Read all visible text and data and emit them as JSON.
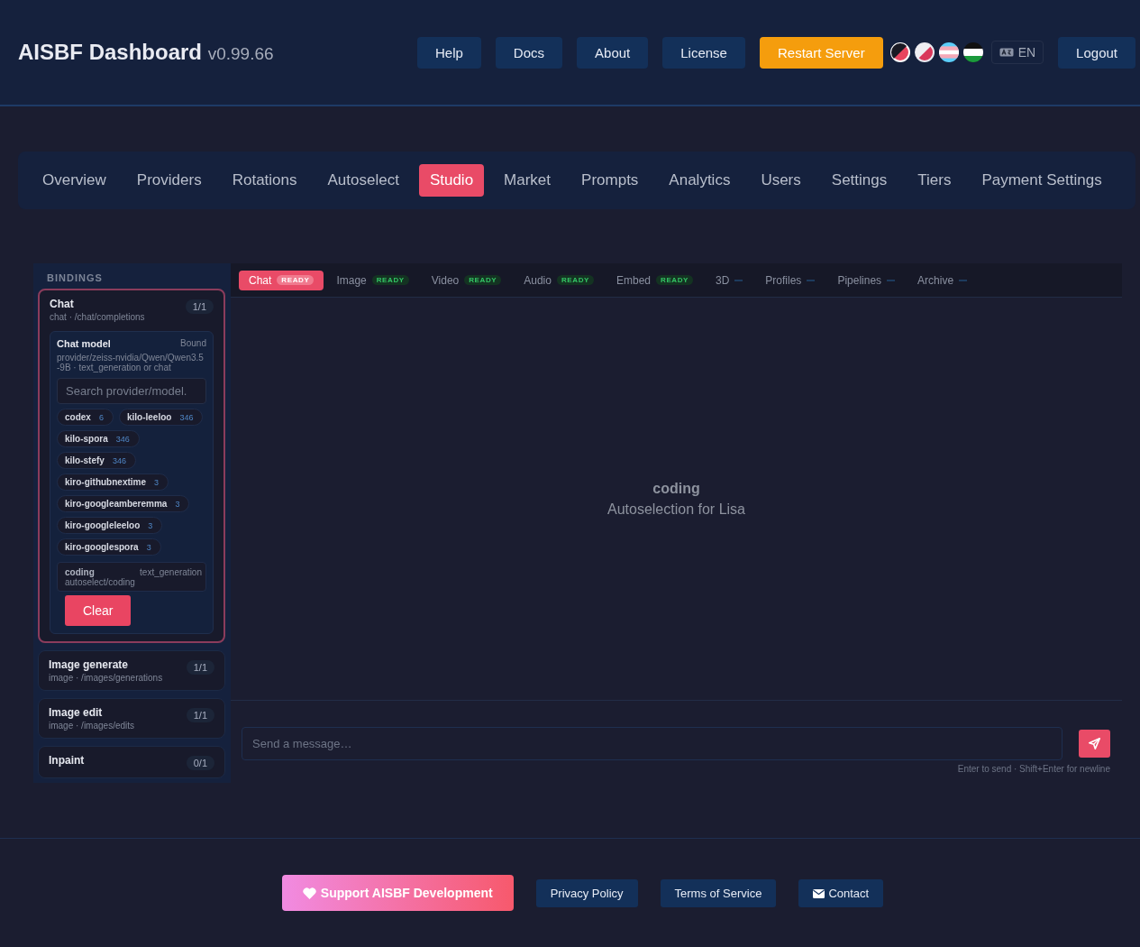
{
  "header": {
    "title": "AISBF Dashboard",
    "version": "v0.99.66",
    "buttons": [
      {
        "label": "Help",
        "kind": "plain"
      },
      {
        "label": "Docs",
        "kind": "plain"
      },
      {
        "label": "About",
        "kind": "plain"
      },
      {
        "label": "License",
        "kind": "plain"
      },
      {
        "label": "Restart Server",
        "kind": "warning"
      }
    ],
    "language": "EN",
    "logout": "Logout"
  },
  "nav": [
    {
      "label": "Overview",
      "selected": false
    },
    {
      "label": "Providers",
      "selected": false
    },
    {
      "label": "Rotations",
      "selected": false
    },
    {
      "label": "Autoselect",
      "selected": false
    },
    {
      "label": "Studio",
      "selected": true
    },
    {
      "label": "Market",
      "selected": false
    },
    {
      "label": "Prompts",
      "selected": false
    },
    {
      "label": "Analytics",
      "selected": false
    },
    {
      "label": "Users",
      "selected": false
    },
    {
      "label": "Settings",
      "selected": false
    },
    {
      "label": "Tiers",
      "selected": false
    },
    {
      "label": "Payment Settings",
      "selected": false
    }
  ],
  "sidebar": {
    "heading": "BINDINGS",
    "bindings": [
      {
        "name": "Chat",
        "path": "chat · /chat/completions",
        "count": "1/1",
        "expanded": true,
        "model": {
          "title": "Chat model",
          "status": "Bound",
          "detail": "provider/zeiss-nvidia/Qwen/Qwen3.5-9B · text_generation or chat",
          "search_placeholder": "Search provider/model.",
          "providers": [
            {
              "name": "codex",
              "count": "6"
            },
            {
              "name": "kilo-leeloo",
              "count": "346"
            },
            {
              "name": "kilo-spora",
              "count": "346"
            },
            {
              "name": "kilo-stefy",
              "count": "346"
            },
            {
              "name": "kiro-githubnextime",
              "count": "3"
            },
            {
              "name": "kiro-googleamberemma",
              "count": "3"
            },
            {
              "name": "kiro-googleleeloo",
              "count": "3"
            },
            {
              "name": "kiro-googlespora",
              "count": "3"
            }
          ],
          "result": {
            "name": "coding",
            "type": "text_generation",
            "path": "autoselect/coding"
          },
          "clear": "Clear"
        }
      },
      {
        "name": "Image generate",
        "path": "image · /images/generations",
        "count": "1/1",
        "expanded": false
      },
      {
        "name": "Image edit",
        "path": "image · /images/edits",
        "count": "1/1",
        "expanded": false
      },
      {
        "name": "Inpaint",
        "count": "0/1",
        "expanded": false
      }
    ]
  },
  "tabs": [
    {
      "label": "Chat",
      "selected": true,
      "badge": "READY"
    },
    {
      "label": "Image",
      "selected": false,
      "badge": "READY"
    },
    {
      "label": "Video",
      "selected": false,
      "badge": "READY"
    },
    {
      "label": "Audio",
      "selected": false,
      "badge": "READY"
    },
    {
      "label": "Embed",
      "selected": false,
      "badge": "READY"
    },
    {
      "label": "3D",
      "selected": false
    },
    {
      "label": "Profiles",
      "selected": false
    },
    {
      "label": "Pipelines",
      "selected": false
    },
    {
      "label": "Archive",
      "selected": false
    }
  ],
  "conversation": {
    "title": "coding",
    "subtitle": "Autoselection for Lisa"
  },
  "composer": {
    "placeholder": "Send a message…",
    "hint": "Enter to send · Shift+Enter for newline"
  },
  "footer": {
    "support": "Support AISBF Development",
    "links": [
      {
        "label": "Privacy Policy",
        "kind": "plain"
      },
      {
        "label": "Terms of Service",
        "kind": "plain"
      },
      {
        "label": "Contact",
        "kind": "mail"
      }
    ]
  }
}
